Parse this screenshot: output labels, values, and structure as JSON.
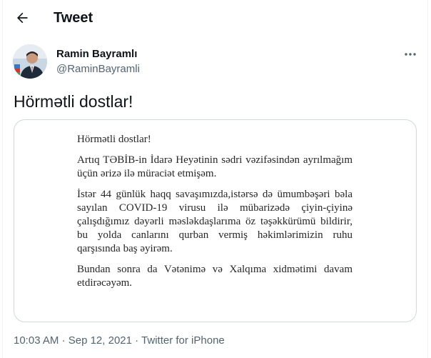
{
  "header": {
    "title": "Tweet"
  },
  "author": {
    "name": "Ramin Bayramlı",
    "handle": "@RaminBayramli"
  },
  "tweet": {
    "text": "Hörmətli dostlar!"
  },
  "media": {
    "paragraphs": [
      "Hörmətli dostlar!",
      "Artıq TƏBİB-in İdarə Heyətinin sədri vəzifəsindən ayrılmağım üçün ərizə ilə müraciət etmişəm.",
      "İstər 44 günlük haqq savaşımızda,istərsə də ümumbəşəri bəla sayılan COVID-19 virusu ilə mübarizədə çiyin-çiyinə çalışdığımız dəyərli məsləkdaşlarıma öz təşəkkürümü bildirir, bu yolda canlarını qurban vermiş həkimlərimizin ruhu qarşısında baş əyirəm.",
      "Bundan sonra da Vətənimə və Xalqıma xidmətimi davam etdirəcəyəm."
    ]
  },
  "meta": {
    "time": "10:03 AM",
    "separator1": " · ",
    "date": "Sep 12, 2021",
    "separator2": " · ",
    "source": "Twitter for iPhone"
  },
  "icons": {
    "back": "arrow-left-icon",
    "more": "more-horizontal-icon"
  },
  "colors": {
    "text_primary": "#0f1419",
    "text_secondary": "#536471",
    "border": "#cfd9de"
  }
}
